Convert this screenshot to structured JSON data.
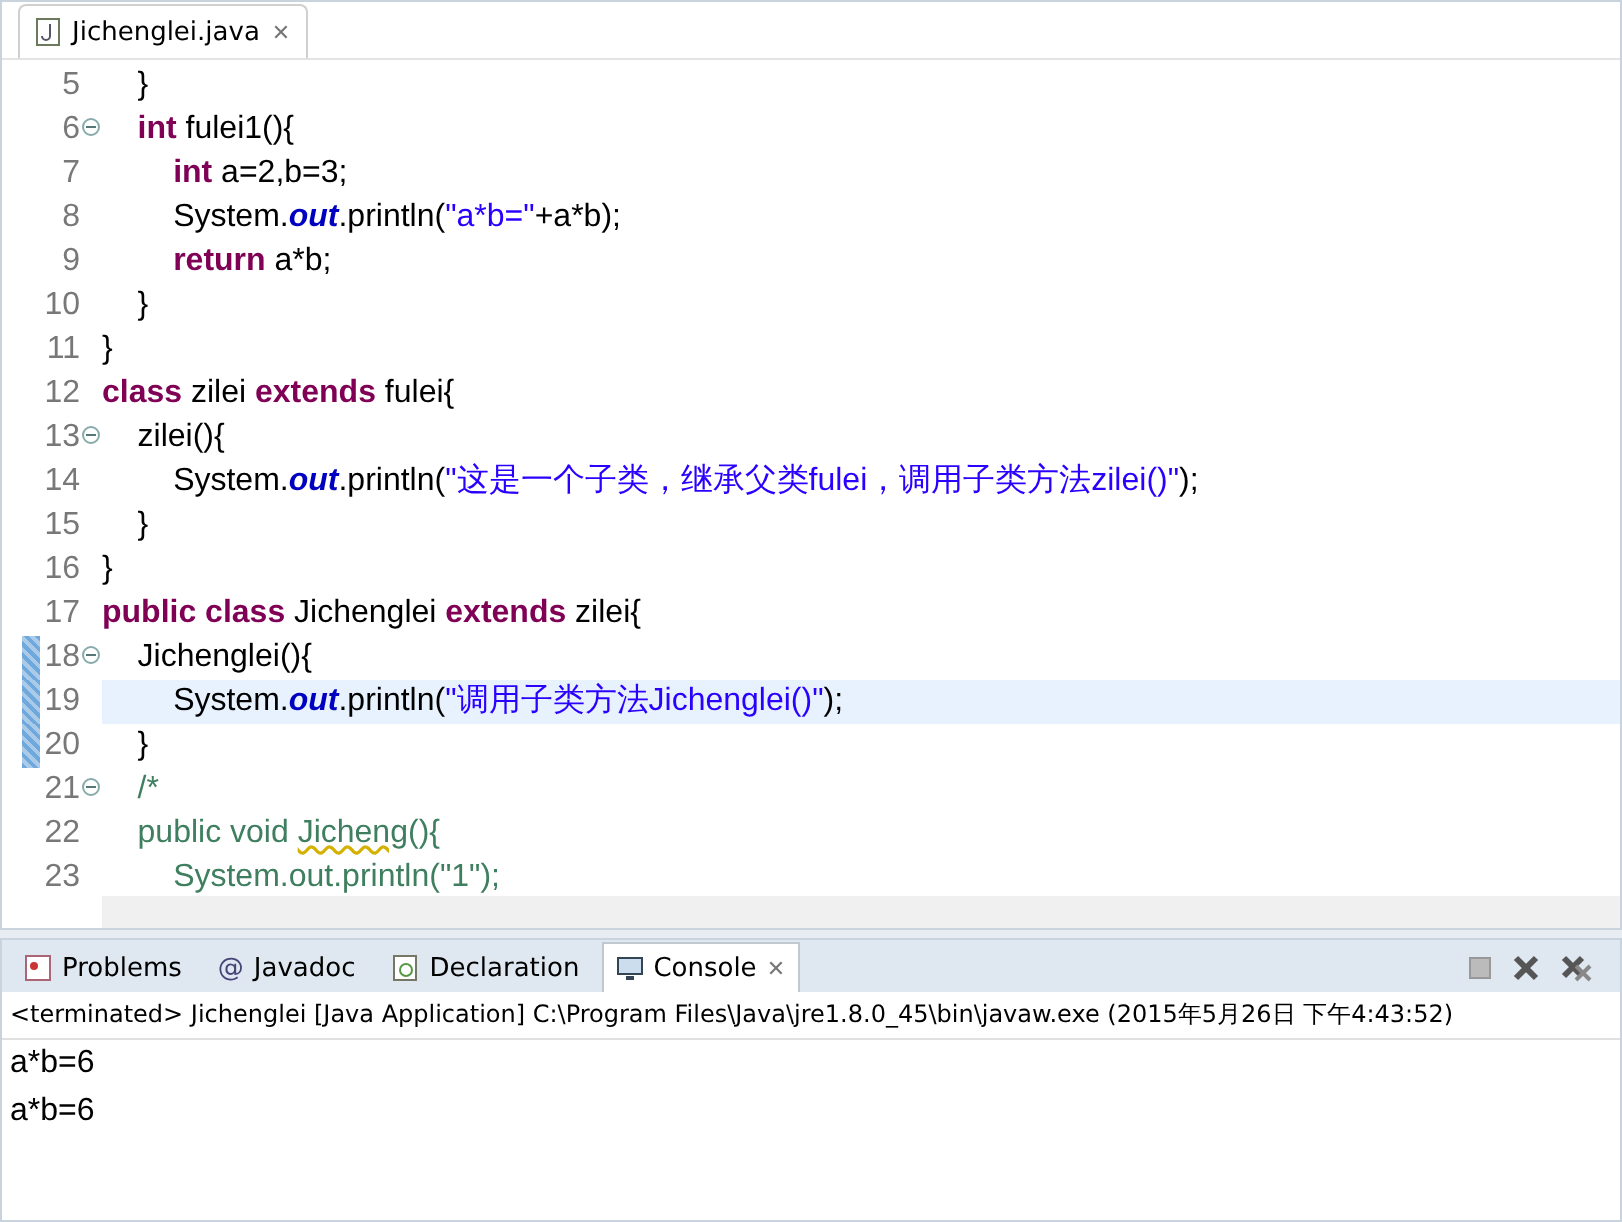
{
  "editor_tab": {
    "label": "Jichenglei.java",
    "close": "✕",
    "selected": true
  },
  "code_lines": [
    {
      "number": "5",
      "fold": false,
      "current": false,
      "changed": false,
      "segments": [
        {
          "kind": "plain",
          "text": "    }"
        }
      ]
    },
    {
      "number": "6",
      "fold": true,
      "current": false,
      "changed": false,
      "segments": [
        {
          "kind": "keyword",
          "text": "    int"
        },
        {
          "kind": "plain",
          "text": " fulei1(){"
        }
      ]
    },
    {
      "number": "7",
      "fold": false,
      "current": false,
      "changed": false,
      "segments": [
        {
          "kind": "keyword",
          "text": "        int"
        },
        {
          "kind": "plain",
          "text": " a=2,b=3;"
        }
      ]
    },
    {
      "number": "8",
      "fold": false,
      "current": false,
      "changed": false,
      "segments": [
        {
          "kind": "plain",
          "text": "        System."
        },
        {
          "kind": "field",
          "text": "out"
        },
        {
          "kind": "plain",
          "text": ".println("
        },
        {
          "kind": "string",
          "text": "\"a*b=\""
        },
        {
          "kind": "plain",
          "text": "+a*b);"
        }
      ]
    },
    {
      "number": "9",
      "fold": false,
      "current": false,
      "changed": false,
      "segments": [
        {
          "kind": "keyword",
          "text": "        return"
        },
        {
          "kind": "plain",
          "text": " a*b;"
        }
      ]
    },
    {
      "number": "10",
      "fold": false,
      "current": false,
      "changed": false,
      "segments": [
        {
          "kind": "plain",
          "text": "    }"
        }
      ]
    },
    {
      "number": "11",
      "fold": false,
      "current": false,
      "changed": false,
      "segments": [
        {
          "kind": "plain",
          "text": "}"
        }
      ]
    },
    {
      "number": "12",
      "fold": false,
      "current": false,
      "changed": false,
      "segments": [
        {
          "kind": "keyword",
          "text": "class"
        },
        {
          "kind": "plain",
          "text": " zilei "
        },
        {
          "kind": "keyword",
          "text": "extends"
        },
        {
          "kind": "plain",
          "text": " fulei{"
        }
      ]
    },
    {
      "number": "13",
      "fold": true,
      "current": false,
      "changed": false,
      "segments": [
        {
          "kind": "plain",
          "text": "    zilei(){"
        }
      ]
    },
    {
      "number": "14",
      "fold": false,
      "current": false,
      "changed": false,
      "segments": [
        {
          "kind": "plain",
          "text": "        System."
        },
        {
          "kind": "field",
          "text": "out"
        },
        {
          "kind": "plain",
          "text": ".println("
        },
        {
          "kind": "string",
          "text": "\"这是一个子类，继承父类fulei，调用子类方法zilei()\""
        },
        {
          "kind": "plain",
          "text": ");"
        }
      ]
    },
    {
      "number": "15",
      "fold": false,
      "current": false,
      "changed": false,
      "segments": [
        {
          "kind": "plain",
          "text": "    }"
        }
      ]
    },
    {
      "number": "16",
      "fold": false,
      "current": false,
      "changed": false,
      "segments": [
        {
          "kind": "plain",
          "text": "}"
        }
      ]
    },
    {
      "number": "17",
      "fold": false,
      "current": false,
      "changed": false,
      "segments": [
        {
          "kind": "keyword",
          "text": "public class"
        },
        {
          "kind": "plain",
          "text": " Jichenglei "
        },
        {
          "kind": "keyword",
          "text": "extends"
        },
        {
          "kind": "plain",
          "text": " zilei{"
        }
      ]
    },
    {
      "number": "18",
      "fold": true,
      "current": false,
      "changed": true,
      "segments": [
        {
          "kind": "plain",
          "text": "    Jichenglei(){"
        }
      ]
    },
    {
      "number": "19",
      "fold": false,
      "current": true,
      "changed": true,
      "segments": [
        {
          "kind": "plain",
          "text": "        System."
        },
        {
          "kind": "field",
          "text": "out"
        },
        {
          "kind": "plain",
          "text": ".println("
        },
        {
          "kind": "string",
          "text": "\"调用子类方法Jichenglei()\""
        },
        {
          "kind": "plain",
          "text": ");"
        }
      ]
    },
    {
      "number": "20",
      "fold": false,
      "current": false,
      "changed": true,
      "segments": [
        {
          "kind": "plain",
          "text": "    }"
        }
      ]
    },
    {
      "number": "21",
      "fold": true,
      "current": false,
      "changed": false,
      "segments": [
        {
          "kind": "comment",
          "text": "    /*"
        }
      ]
    },
    {
      "number": "22",
      "fold": false,
      "current": false,
      "changed": false,
      "segments": [
        {
          "kind": "comment",
          "text": "    public void "
        },
        {
          "kind": "warning",
          "text": "Jicheng"
        },
        {
          "kind": "comment",
          "text": "(){"
        }
      ]
    },
    {
      "number": "23",
      "fold": false,
      "current": false,
      "changed": false,
      "segments": [
        {
          "kind": "comment",
          "text": "        System.out.println(\"1\");"
        }
      ]
    }
  ],
  "console_tabs": [
    {
      "label": "Problems",
      "selected": false
    },
    {
      "label": "Javadoc",
      "selected": false,
      "glyph": "@"
    },
    {
      "label": "Declaration",
      "selected": false
    },
    {
      "label": "Console",
      "selected": true,
      "close": "✕"
    }
  ],
  "console_status": "<terminated> Jichenglei [Java Application] C:\\Program Files\\Java\\jre1.8.0_45\\bin\\javaw.exe (2015年5月26日 下午4:43:52)",
  "console_output": [
    "a*b=6",
    "a*b=6"
  ]
}
